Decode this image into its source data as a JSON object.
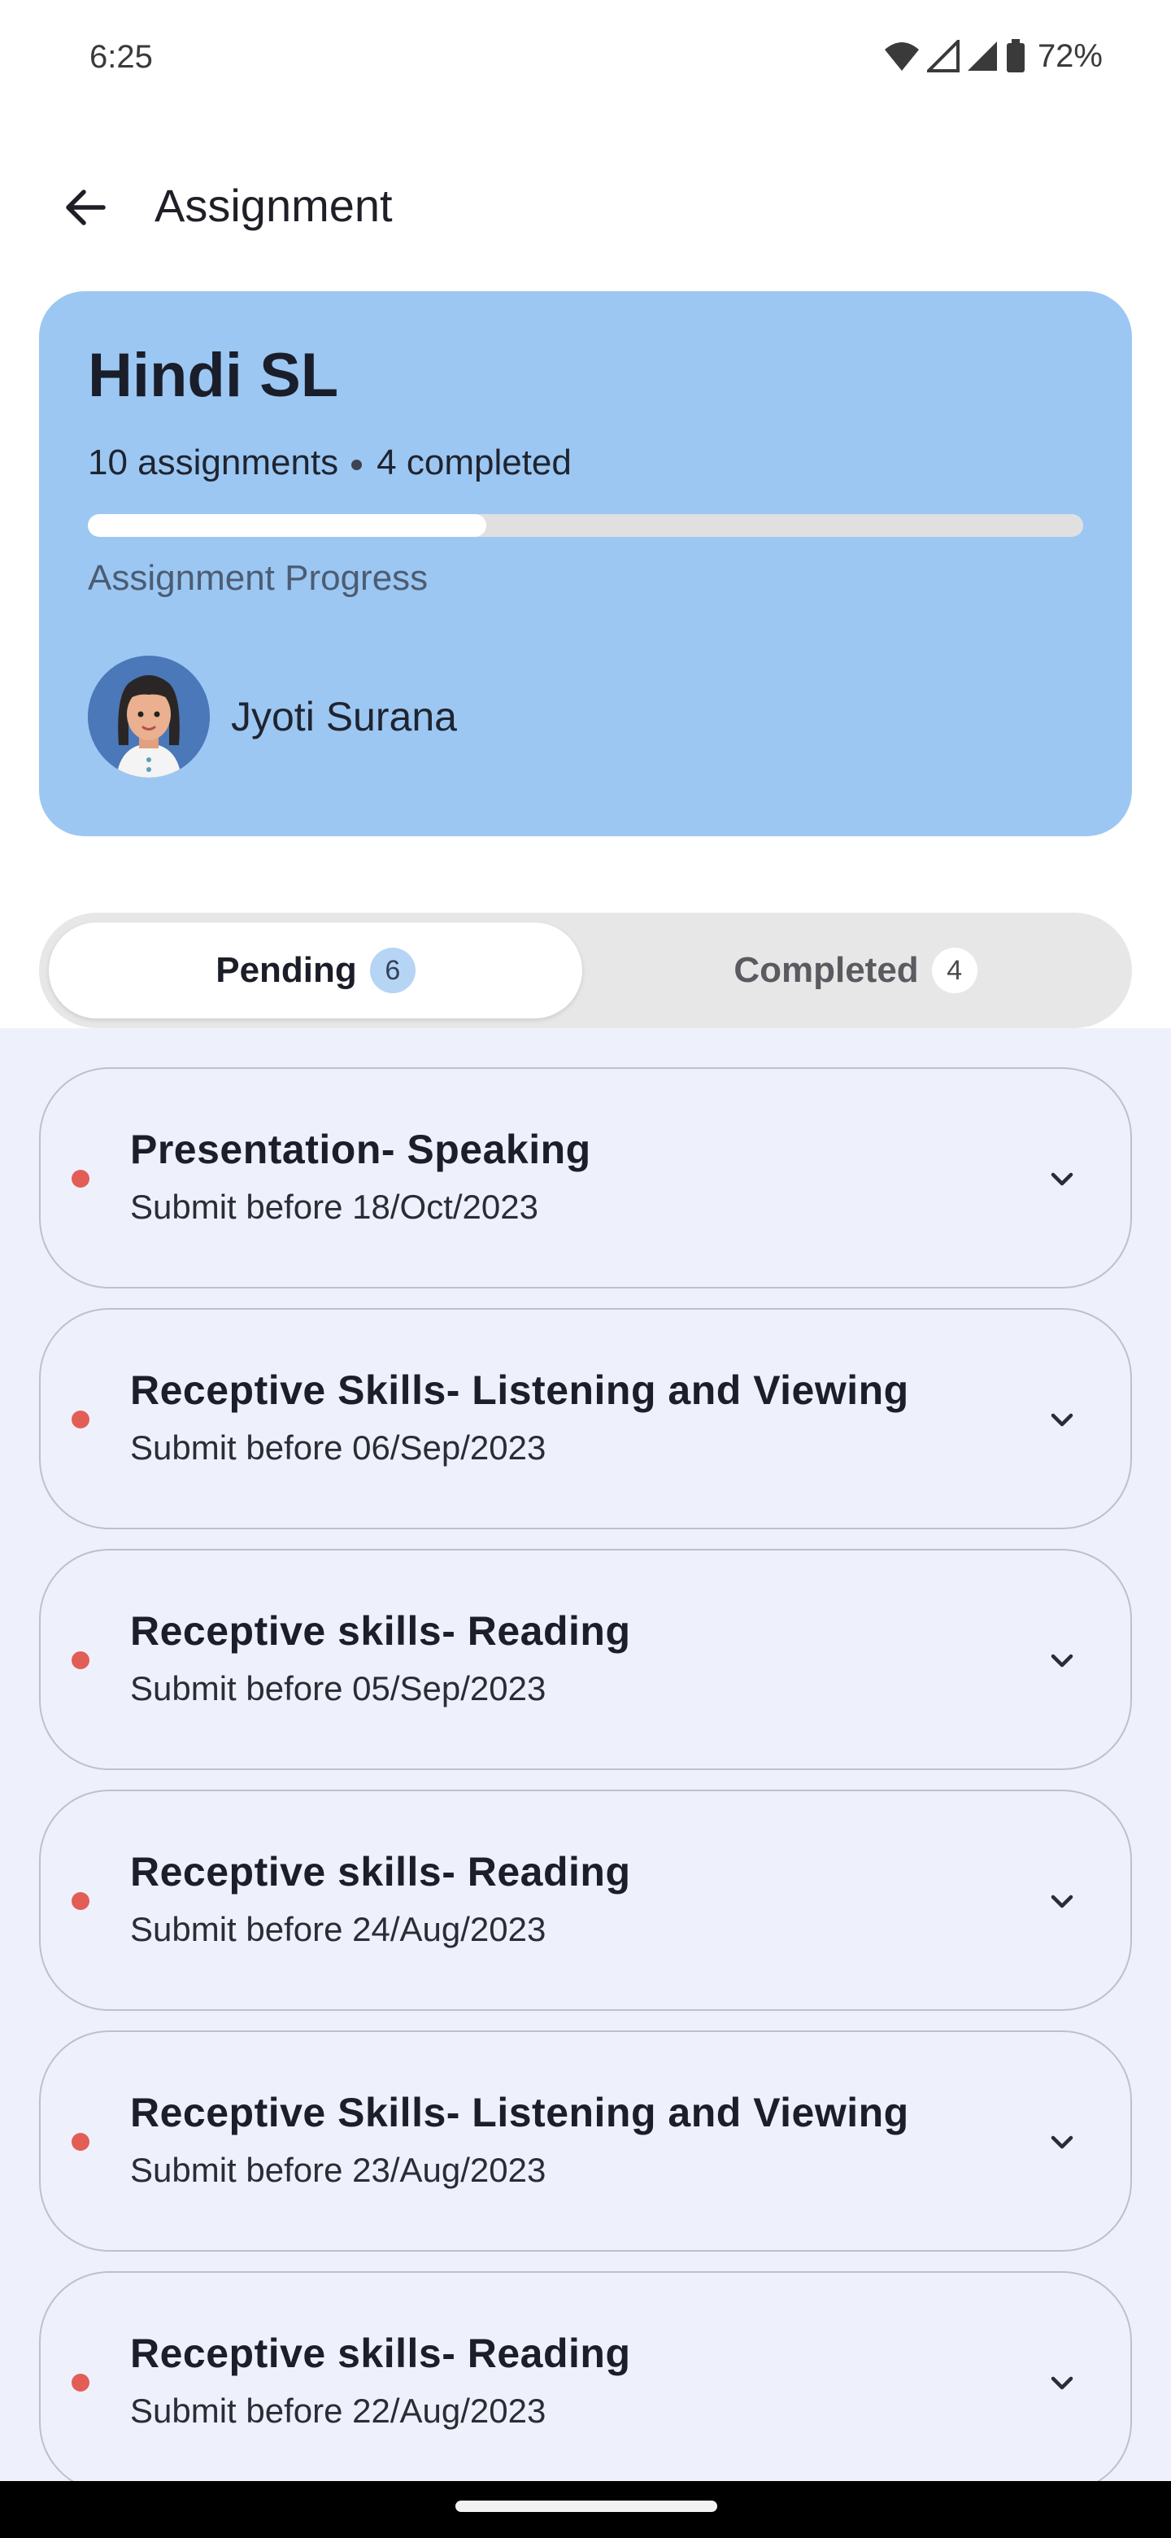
{
  "status_bar": {
    "time": "6:25",
    "battery": "72%",
    "icons": [
      "wifi-icon",
      "signal-icon",
      "signal-icon",
      "battery-icon"
    ]
  },
  "header": {
    "title": "Assignment",
    "back_icon": "arrow-left-icon"
  },
  "summary": {
    "course": "Hindi SL",
    "assignments_text": "10 assignments",
    "completed_text": "4 completed",
    "progress_fraction": 0.4,
    "progress_label": "Assignment Progress",
    "teacher_name": "Jyoti Surana",
    "card_color": "#9cc7f2"
  },
  "tabs": [
    {
      "label": "Pending",
      "count": "6",
      "selected": true
    },
    {
      "label": "Completed",
      "count": "4",
      "selected": false
    }
  ],
  "assignments": [
    {
      "title": "Presentation- Speaking",
      "due": "Submit before 18/Oct/2023"
    },
    {
      "title": "Receptive Skills- Listening and Viewing",
      "due": "Submit before 06/Sep/2023"
    },
    {
      "title": "Receptive skills- Reading",
      "due": "Submit before 05/Sep/2023"
    },
    {
      "title": "Receptive skills- Reading",
      "due": "Submit before 24/Aug/2023"
    },
    {
      "title": "Receptive Skills- Listening and Viewing",
      "due": "Submit before 23/Aug/2023"
    },
    {
      "title": "Receptive skills- Reading",
      "due": "Submit before 22/Aug/2023"
    }
  ],
  "colors": {
    "pending_dot": "#e35d57",
    "list_background": "#eef1fb"
  }
}
